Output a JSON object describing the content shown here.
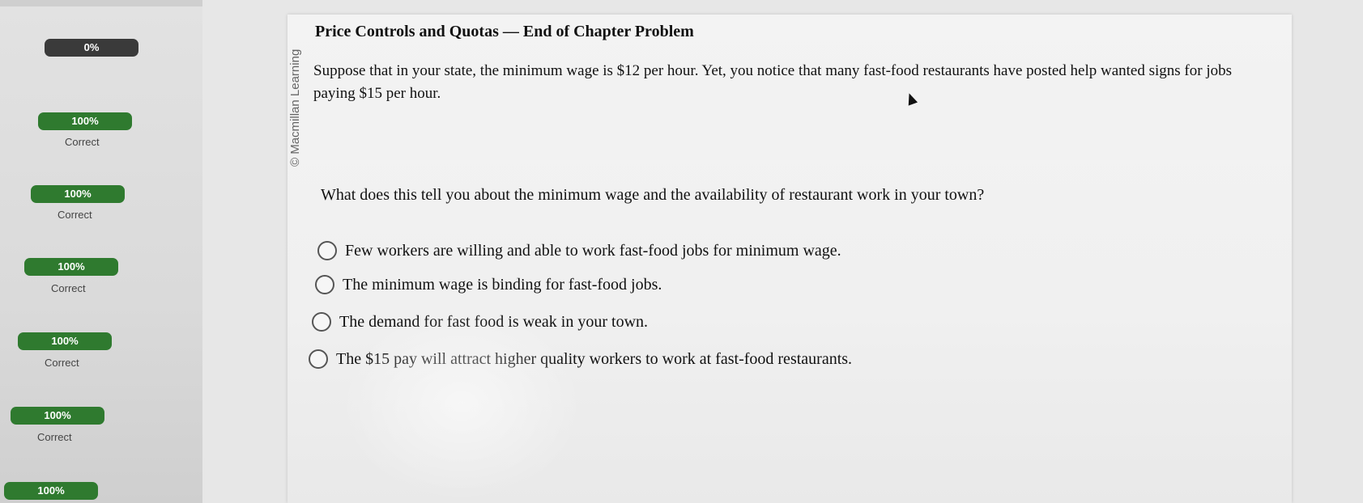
{
  "sidebar": {
    "items": [
      {
        "percent": "0%",
        "status": ""
      },
      {
        "percent": "100%",
        "status": "Correct"
      },
      {
        "percent": "100%",
        "status": "Correct"
      },
      {
        "percent": "100%",
        "status": "Correct"
      },
      {
        "percent": "100%",
        "status": "Correct"
      },
      {
        "percent": "100%",
        "status": "Correct"
      },
      {
        "percent": "100%",
        "status": ""
      }
    ],
    "colors": {
      "complete": "#2f7a2f",
      "incomplete": "#3a3a3a"
    }
  },
  "problem": {
    "copyright": "© Macmillan Learning",
    "title": "Price Controls and Quotas — End of Chapter Problem",
    "scenario": "Suppose that in your state, the minimum wage is $12 per hour. Yet, you notice that many fast-food restaurants have posted help wanted signs for jobs paying $15 per hour.",
    "question": "What does this tell you about the minimum wage and the availability of restaurant work in your town?",
    "options": [
      "Few workers are willing and able to work fast-food jobs for minimum wage.",
      "The minimum wage is binding for fast-food jobs.",
      "The demand for fast food is weak in your town.",
      "The $15 pay will attract higher quality workers to work at fast-food restaurants."
    ]
  }
}
